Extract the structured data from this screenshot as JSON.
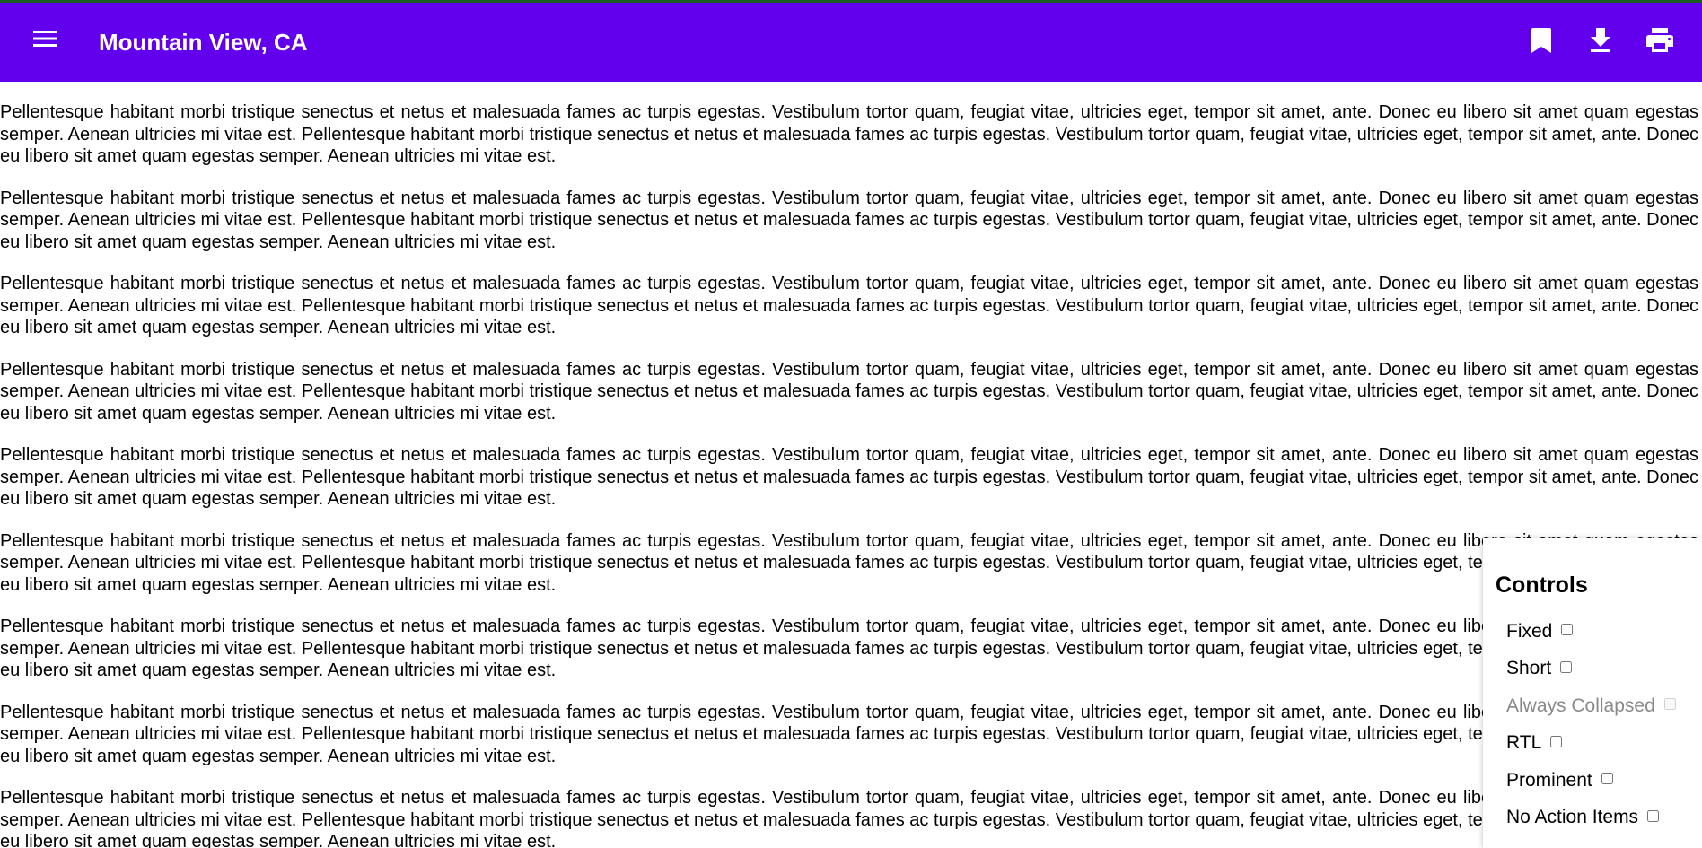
{
  "app_bar": {
    "title": "Mountain View, CA",
    "nav_icon": "menu-icon",
    "actions": [
      {
        "name": "bookmark",
        "icon": "bookmark-icon"
      },
      {
        "name": "download",
        "icon": "download-icon"
      },
      {
        "name": "print",
        "icon": "print-icon"
      }
    ],
    "background_color": "#6200ee",
    "top_border_color": "#1b5e20"
  },
  "content": {
    "paragraph_text": "Pellentesque habitant morbi tristique senectus et netus et malesuada fames ac turpis egestas. Vestibulum tortor quam, feugiat vitae, ultricies eget, tempor sit amet, ante. Donec eu libero sit amet quam egestas semper. Aenean ultricies mi vitae est. Pellentesque habitant morbi tristique senectus et netus et malesuada fames ac turpis egestas. Vestibulum tortor quam, feugiat vitae, ultricies eget, tempor sit amet, ante. Donec eu libero sit amet quam egestas semper. Aenean ultricies mi vitae est.",
    "paragraphs": [
      "Pellentesque habitant morbi tristique senectus et netus et malesuada fames ac turpis egestas. Vestibulum tortor quam, feugiat vitae, ultricies eget, tempor sit amet, ante. Donec eu libero sit amet quam egestas semper. Aenean ultricies mi vitae est. Pellentesque habitant morbi tristique senectus et netus et malesuada fames ac turpis egestas. Vestibulum tortor quam, feugiat vitae, ultricies eget, tempor sit amet, ante. Donec eu libero sit amet quam egestas semper. Aenean ultricies mi vitae est.",
      "Pellentesque habitant morbi tristique senectus et netus et malesuada fames ac turpis egestas. Vestibulum tortor quam, feugiat vitae, ultricies eget, tempor sit amet, ante. Donec eu libero sit amet quam egestas semper. Aenean ultricies mi vitae est. Pellentesque habitant morbi tristique senectus et netus et malesuada fames ac turpis egestas. Vestibulum tortor quam, feugiat vitae, ultricies eget, tempor sit amet, ante. Donec eu libero sit amet quam egestas semper. Aenean ultricies mi vitae est.",
      "Pellentesque habitant morbi tristique senectus et netus et malesuada fames ac turpis egestas. Vestibulum tortor quam, feugiat vitae, ultricies eget, tempor sit amet, ante. Donec eu libero sit amet quam egestas semper. Aenean ultricies mi vitae est. Pellentesque habitant morbi tristique senectus et netus et malesuada fames ac turpis egestas. Vestibulum tortor quam, feugiat vitae, ultricies eget, tempor sit amet, ante. Donec eu libero sit amet quam egestas semper. Aenean ultricies mi vitae est.",
      "Pellentesque habitant morbi tristique senectus et netus et malesuada fames ac turpis egestas. Vestibulum tortor quam, feugiat vitae, ultricies eget, tempor sit amet, ante. Donec eu libero sit amet quam egestas semper. Aenean ultricies mi vitae est. Pellentesque habitant morbi tristique senectus et netus et malesuada fames ac turpis egestas. Vestibulum tortor quam, feugiat vitae, ultricies eget, tempor sit amet, ante. Donec eu libero sit amet quam egestas semper. Aenean ultricies mi vitae est.",
      "Pellentesque habitant morbi tristique senectus et netus et malesuada fames ac turpis egestas. Vestibulum tortor quam, feugiat vitae, ultricies eget, tempor sit amet, ante. Donec eu libero sit amet quam egestas semper. Aenean ultricies mi vitae est. Pellentesque habitant morbi tristique senectus et netus et malesuada fames ac turpis egestas. Vestibulum tortor quam, feugiat vitae, ultricies eget, tempor sit amet, ante. Donec eu libero sit amet quam egestas semper. Aenean ultricies mi vitae est.",
      "Pellentesque habitant morbi tristique senectus et netus et malesuada fames ac turpis egestas. Vestibulum tortor quam, feugiat vitae, ultricies eget, tempor sit amet, ante. Donec eu libero sit amet quam egestas semper. Aenean ultricies mi vitae est. Pellentesque habitant morbi tristique senectus et netus et malesuada fames ac turpis egestas. Vestibulum tortor quam, feugiat vitae, ultricies eget, tempor sit amet, ante. Donec eu libero sit amet quam egestas semper. Aenean ultricies mi vitae est.",
      "Pellentesque habitant morbi tristique senectus et netus et malesuada fames ac turpis egestas. Vestibulum tortor quam, feugiat vitae, ultricies eget, tempor sit amet, ante. Donec eu libero sit amet quam egestas semper. Aenean ultricies mi vitae est. Pellentesque habitant morbi tristique senectus et netus et malesuada fames ac turpis egestas. Vestibulum tortor quam, feugiat vitae, ultricies eget, tempor sit amet, ante. Donec eu libero sit amet quam egestas semper. Aenean ultricies mi vitae est.",
      "Pellentesque habitant morbi tristique senectus et netus et malesuada fames ac turpis egestas. Vestibulum tortor quam, feugiat vitae, ultricies eget, tempor sit amet, ante. Donec eu libero sit amet quam egestas semper. Aenean ultricies mi vitae est. Pellentesque habitant morbi tristique senectus et netus et malesuada fames ac turpis egestas. Vestibulum tortor quam, feugiat vitae, ultricies eget, tempor sit amet, ante. Donec eu libero sit amet quam egestas semper. Aenean ultricies mi vitae est.",
      "Pellentesque habitant morbi tristique senectus et netus et malesuada fames ac turpis egestas. Vestibulum tortor quam, feugiat vitae, ultricies eget, tempor sit amet, ante. Donec eu libero sit amet quam egestas semper. Aenean ultricies mi vitae est. Pellentesque habitant morbi tristique senectus et netus et malesuada fames ac turpis egestas. Vestibulum tortor quam, feugiat vitae, ultricies eget, tempor sit amet, ante. Donec eu libero sit amet quam egestas semper. Aenean ultricies mi vitae est."
    ]
  },
  "controls": {
    "title": "Controls",
    "options": [
      {
        "label": "Fixed",
        "checked": false,
        "disabled": false
      },
      {
        "label": "Short",
        "checked": false,
        "disabled": false
      },
      {
        "label": "Always Collapsed",
        "checked": false,
        "disabled": true
      },
      {
        "label": "RTL",
        "checked": false,
        "disabled": false
      },
      {
        "label": "Prominent",
        "checked": false,
        "disabled": false
      },
      {
        "label": "No Action Items",
        "checked": false,
        "disabled": false
      }
    ]
  }
}
